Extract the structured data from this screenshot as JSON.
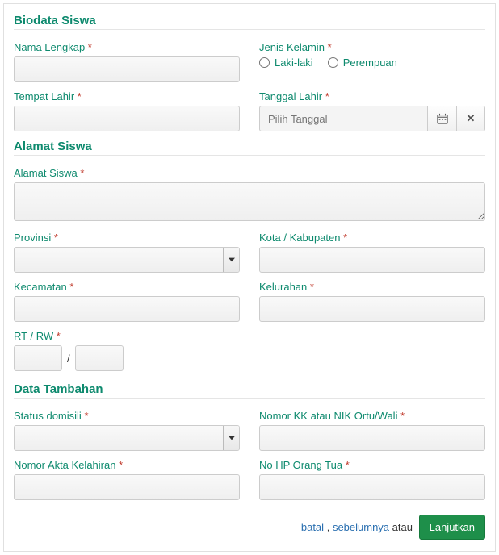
{
  "sections": {
    "biodata": "Biodata Siswa",
    "alamat": "Alamat Siswa",
    "tambahan": "Data Tambahan"
  },
  "labels": {
    "nama_lengkap": "Nama Lengkap",
    "jenis_kelamin": "Jenis Kelamin",
    "tempat_lahir": "Tempat Lahir",
    "tanggal_lahir": "Tanggal Lahir",
    "alamat_siswa": "Alamat Siswa",
    "provinsi": "Provinsi",
    "kota": "Kota / Kabupaten",
    "kecamatan": "Kecamatan",
    "kelurahan": "Kelurahan",
    "rt_rw": "RT / RW",
    "status_domisili": "Status domisili",
    "nomor_kk": "Nomor KK atau NIK Ortu/Wali",
    "nomor_akta": "Nomor Akta Kelahiran",
    "no_hp": "No HP Orang Tua"
  },
  "req": "*",
  "values": {
    "nama_lengkap": "",
    "tempat_lahir": "",
    "tanggal_lahir": "",
    "alamat_siswa": "",
    "provinsi": "",
    "kota": "",
    "kecamatan": "",
    "kelurahan": "",
    "rt": "",
    "rw": "",
    "rt_rw_sep": "/",
    "status_domisili": "",
    "nomor_kk": "",
    "nomor_akta": "",
    "no_hp": ""
  },
  "placeholders": {
    "tanggal_lahir": "Pilih Tanggal"
  },
  "gender_options": {
    "laki": "Laki-laki",
    "perempuan": "Perempuan"
  },
  "footer": {
    "batal": "batal",
    "comma": ",",
    "sebelumnya": "sebelumnya",
    "atau": "atau",
    "lanjutkan": "Lanjutkan"
  }
}
